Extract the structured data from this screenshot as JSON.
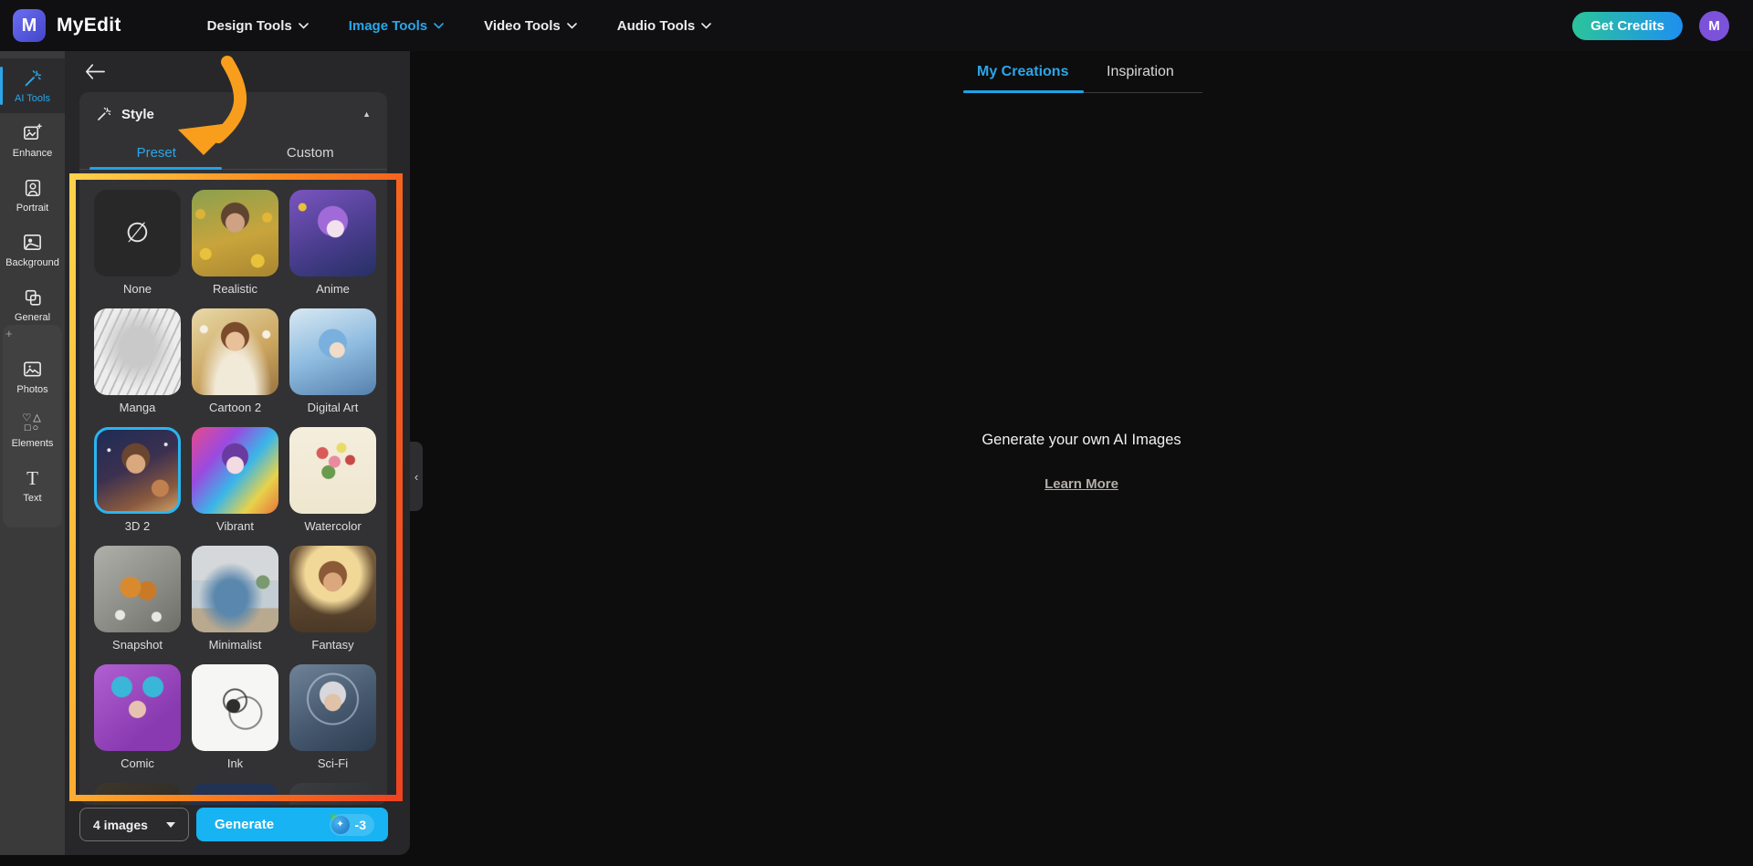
{
  "navbar": {
    "logo_text": "MyEdit",
    "logo_initial": "M",
    "menus": [
      {
        "label": "Design Tools",
        "icon": "chevron-down-icon"
      },
      {
        "label": "Image Tools",
        "icon": "chevron-down-icon",
        "active": true
      },
      {
        "label": "Video Tools",
        "icon": "chevron-down-icon"
      },
      {
        "label": "Audio Tools",
        "icon": "chevron-down-icon"
      }
    ],
    "get_credits_label": "Get Credits",
    "avatar_initial": "M"
  },
  "sidebar": {
    "items": [
      {
        "label": "AI Tools",
        "icon": "magic-wand-icon",
        "active": true
      },
      {
        "label": "Enhance",
        "icon": "image-sparkle-icon"
      },
      {
        "label": "Portrait",
        "icon": "portrait-icon"
      },
      {
        "label": "Background",
        "icon": "background-image-icon"
      },
      {
        "label": "General",
        "icon": "overlapping-squares-icon"
      }
    ],
    "secondary_items": [
      {
        "label": "Photos",
        "icon": "photo-icon"
      },
      {
        "label": "Elements",
        "icon": "shapes-icon"
      },
      {
        "label": "Text",
        "icon": "text-icon"
      }
    ],
    "plus_glyph": "+",
    "elements_icon_rows": [
      "♡△",
      "□○"
    ],
    "text_icon_glyph": "T"
  },
  "panel": {
    "back_icon": "←",
    "collapse_icon": "▲",
    "panel_collapse_icon": "‹",
    "style_section": {
      "title": "Style",
      "tabs": [
        {
          "label": "Preset",
          "active": true
        },
        {
          "label": "Custom"
        }
      ],
      "presets": [
        {
          "label": "None",
          "glyph": "∅"
        },
        {
          "label": "Realistic"
        },
        {
          "label": "Anime"
        },
        {
          "label": "Manga"
        },
        {
          "label": "Cartoon 2"
        },
        {
          "label": "Digital Art"
        },
        {
          "label": "3D 2",
          "selected": true
        },
        {
          "label": "Vibrant"
        },
        {
          "label": "Watercolor"
        },
        {
          "label": "Snapshot"
        },
        {
          "label": "Minimalist"
        },
        {
          "label": "Fantasy"
        },
        {
          "label": "Comic"
        },
        {
          "label": "Ink"
        },
        {
          "label": "Sci-Fi"
        }
      ],
      "selected_preset": "3D 2"
    },
    "footer": {
      "image_count": "4 images",
      "generate_label": "Generate",
      "credit_cost": "-3"
    }
  },
  "main": {
    "tabs": [
      {
        "label": "My Creations",
        "active": true
      },
      {
        "label": "Inspiration"
      }
    ],
    "empty_state": {
      "title": "Generate your own AI Images",
      "link_label": "Learn More"
    }
  },
  "colors": {
    "accent_blue": "#2ba6e9",
    "generate_blue": "#18b3f2",
    "annotation_orange": "#fb8c1e",
    "credits_gradient_start": "#2bc49a",
    "credits_gradient_end": "#1e8ff0",
    "avatar_purple": "#7b52d9"
  }
}
